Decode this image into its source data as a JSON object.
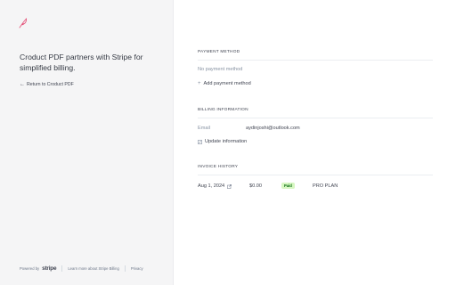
{
  "left": {
    "tagline": "Croduct PDF partners with Stripe for simplified billing.",
    "return_label": "Return to Croduct PDF",
    "footer": {
      "powered_by": "Powered by",
      "brand": "stripe",
      "learn_more": "Learn more about Stripe Billing",
      "privacy": "Privacy"
    }
  },
  "payment_method": {
    "title": "PAYMENT METHOD",
    "empty_text": "No payment method",
    "add_label": "Add payment method"
  },
  "billing_information": {
    "title": "BILLING INFORMATION",
    "email_label": "Email",
    "email_value": "aydinjoshi@outlook.com",
    "update_label": "Update information"
  },
  "invoice_history": {
    "title": "INVOICE HISTORY",
    "invoices": [
      {
        "date": "Aug 1, 2024",
        "amount": "$0.00",
        "status": "Paid",
        "plan": "PRO PLAN"
      }
    ]
  },
  "colors": {
    "brand_logo": "#e5577d",
    "paid_badge_bg": "#d7f7c2",
    "paid_badge_text": "#05690d"
  },
  "icons": {
    "logo": "feather-logo-icon",
    "back": "arrow-left-icon",
    "add": "plus-icon",
    "update": "edit-icon",
    "external": "external-link-icon"
  }
}
